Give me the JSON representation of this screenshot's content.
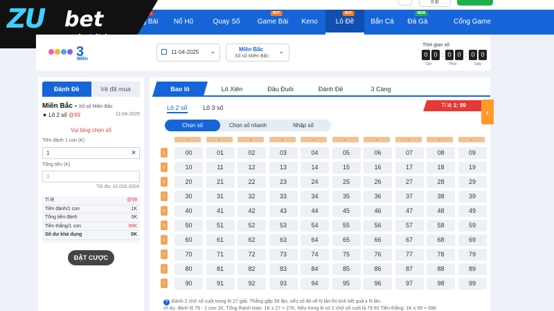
{
  "brand": {
    "logo_main": "ZU",
    "logo_bet": "bet",
    "logo_site": "zubet.ltd",
    "product_number": "3",
    "product_label": "Miền"
  },
  "topbar": {
    "balance": "0 Đ"
  },
  "nav": {
    "items": [
      {
        "label": "Sòng Bài",
        "badge": "LIVE",
        "badge_type": "live"
      },
      {
        "label": "Nổ Hũ"
      },
      {
        "label": "Quay Số"
      },
      {
        "label": "Game Bài",
        "badge": "HOT",
        "badge_type": "hot"
      },
      {
        "label": "Keno"
      },
      {
        "label": "Lô Đề",
        "badge": "HOT",
        "badge_type": "hot",
        "active": true
      },
      {
        "label": "Bắn Cá"
      },
      {
        "label": "Đá Gà",
        "badge": "NEW",
        "badge_type": "new"
      },
      {
        "label": "Cổng Game"
      }
    ]
  },
  "filters": {
    "date": "11-04-2025",
    "region_title": "Miền Bắc",
    "region_sub": "Xổ số Miền Bắc"
  },
  "timer": {
    "label": "Thời gian xổ",
    "digits": [
      "0",
      "0",
      "0",
      "0",
      "0",
      "0"
    ],
    "units": [
      "Giờ",
      "Phút",
      "Giây"
    ]
  },
  "left": {
    "tab_bet": "Đánh Đề",
    "tab_bought": "Vé đã mua",
    "title": "Miền Bắc",
    "title_sub": "Xổ số Miền Bắc",
    "bet_type": "★ Lô 2 số",
    "odds": "@99",
    "date": "11-04-2025",
    "prompt": "Vui lòng chọn số",
    "amount_label": "Tiền đánh 1 con (K)",
    "amount_value": "1",
    "clear_icon": "×",
    "total_label": "Tổng tiền (K)",
    "total_placeholder": "0",
    "max": "Tối đa: 10.000.000K",
    "summary": [
      {
        "label": "Tỉ lệ",
        "value": "@99",
        "red": true
      },
      {
        "label": "Tiền đánh/1 con",
        "value": "1K"
      },
      {
        "label": "Tổng tiền đánh",
        "value": "0K"
      },
      {
        "label": "Tiền thắng/1 con",
        "value": "99K",
        "red": true
      },
      {
        "label": "Số dư khả dụng",
        "value": "0K",
        "bold": true
      }
    ],
    "bet_button": "ĐẶT CƯỢC"
  },
  "right": {
    "tabs": [
      "Bao lô",
      "Lô Xiên",
      "Đầu Đuôi",
      "Đánh Đề",
      "3 Càng"
    ],
    "subtabs": [
      "Lô 2 số",
      "Lô 3 số"
    ],
    "rate_label": "Tỉ lệ",
    "rate_value": "1: 99",
    "modes": [
      "Chọn số",
      "Chọn số nhanh",
      "Nhập số"
    ],
    "side_arrow": "‹",
    "col_arrow": "⌄",
    "row_arrow": "›",
    "numbers": [
      [
        "00",
        "01",
        "02",
        "03",
        "04",
        "05",
        "06",
        "07",
        "08",
        "09"
      ],
      [
        "10",
        "11",
        "12",
        "13",
        "14",
        "15",
        "16",
        "17",
        "18",
        "19"
      ],
      [
        "20",
        "21",
        "22",
        "23",
        "24",
        "25",
        "26",
        "27",
        "28",
        "29"
      ],
      [
        "30",
        "31",
        "32",
        "33",
        "34",
        "35",
        "36",
        "37",
        "38",
        "39"
      ],
      [
        "40",
        "41",
        "42",
        "43",
        "44",
        "45",
        "46",
        "47",
        "48",
        "49"
      ],
      [
        "50",
        "51",
        "52",
        "53",
        "54",
        "55",
        "56",
        "57",
        "58",
        "59"
      ],
      [
        "60",
        "61",
        "62",
        "63",
        "64",
        "65",
        "66",
        "67",
        "68",
        "69"
      ],
      [
        "70",
        "71",
        "72",
        "73",
        "74",
        "75",
        "76",
        "77",
        "78",
        "79"
      ],
      [
        "80",
        "81",
        "82",
        "83",
        "84",
        "85",
        "86",
        "87",
        "88",
        "89"
      ],
      [
        "90",
        "91",
        "92",
        "93",
        "94",
        "95",
        "96",
        "97",
        "98",
        "99"
      ]
    ],
    "info_icon": "?",
    "info_line1": "Đánh 2 chữ số cuối trong lô 27 giải. Thắng gấp 99 lần, nếu số đó về N lần thì tính kết quả x N lần.",
    "info_line2": "Ví dụ: đánh lô 79 - 1 con 1K, Tổng thanh toán: 1K x 27 = 27K. Nếu trong lô có 2 chữ số cuối là 79 thì Tiền thắng: 1K x 99 = 99K"
  }
}
